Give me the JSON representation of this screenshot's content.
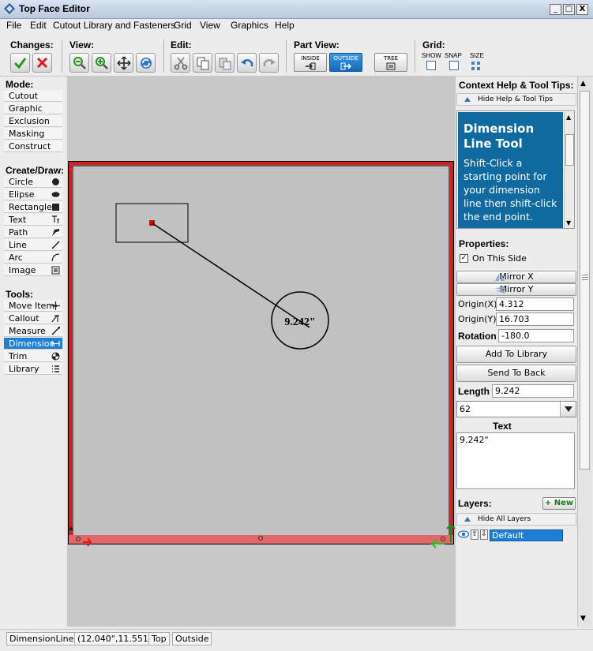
{
  "window": {
    "title": "Top Face Editor",
    "minimize": "_",
    "maximize": "□",
    "close": "X"
  },
  "menu": [
    "File",
    "Edit",
    "Cutout Library and Fasteners",
    "Grid",
    "View",
    "Graphics",
    "Help"
  ],
  "toolbar": {
    "changes_label": "Changes:",
    "view_label": "View:",
    "edit_label": "Edit:",
    "part_view_label": "Part View:",
    "grid_label": "Grid:",
    "inside": "INSIDE",
    "outside": "OUTSIDE",
    "tree": "TREE",
    "grid_options": [
      "SHOW",
      "SNAP",
      "SIZE"
    ]
  },
  "left": {
    "mode_label": "Mode:",
    "modes": [
      "Cutout",
      "Graphic",
      "Exclusion",
      "Masking",
      "Construct"
    ],
    "create_label": "Create/Draw:",
    "create": [
      "Circle",
      "Elipse",
      "Rectangle",
      "Text",
      "Path",
      "Line",
      "Arc",
      "Image"
    ],
    "tools_label": "Tools:",
    "tools": [
      "Move Item",
      "Callout",
      "Measure",
      "Dimension",
      "Trim",
      "Library"
    ],
    "selected_tool": "Dimension"
  },
  "canvas": {
    "dimension_text": "9.242\""
  },
  "right": {
    "help_title": "Context Help & Tool Tips:",
    "hide_help": "Hide Help & Tool Tips",
    "help_heading": "Dimension Line Tool",
    "help_body": "Shift-Click a starting point for your dimension line then shift-click the end point.",
    "properties_label": "Properties:",
    "on_this_side": "On This Side",
    "mirror_x": "Mirror X",
    "mirror_y": "Mirror Y",
    "origin_x_label": "Origin(X)",
    "origin_x": "4.312",
    "origin_y_label": "Origin(Y)",
    "origin_y": "16.703",
    "rotation_label": "Rotation",
    "rotation": "-180.0",
    "add_to_library": "Add To Library",
    "send_to_back": "Send To Back",
    "length_label": "Length",
    "length": "9.242",
    "font_size": "62",
    "text_label": "Text",
    "text_value": "9.242\"",
    "layers_label": "Layers:",
    "new_layer": "+ New",
    "hide_layers": "Hide All Layers",
    "layer_name": "Default"
  },
  "status": {
    "mode": "DimensionLines",
    "coords": "(12.040\",11.551\")",
    "side": "Top",
    "view": "Outside"
  },
  "colors": {
    "accent": "#1e7fd6",
    "help_bg": "#0f6aa0",
    "outline_red": "#d21e1e"
  }
}
